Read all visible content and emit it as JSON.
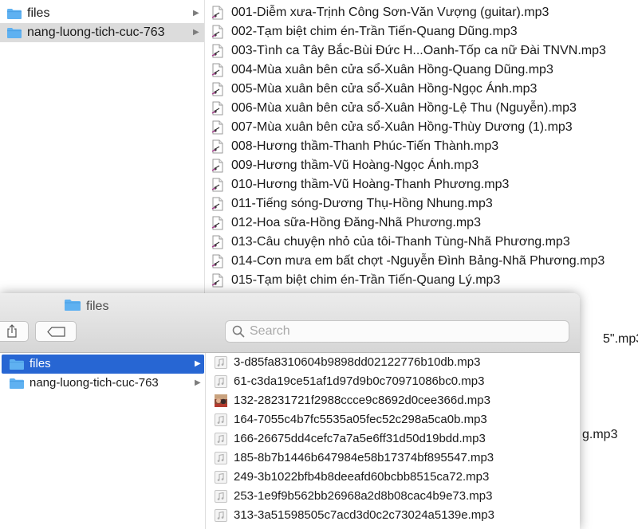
{
  "back_window": {
    "sidebar": [
      {
        "label": "files",
        "selected": false
      },
      {
        "label": "nang-luong-tich-cuc-763",
        "selected": true
      }
    ],
    "files": [
      "001-Diễm xưa-Trịnh Công Sơn-Văn Vượng (guitar).mp3",
      "002-Tạm biệt chim én-Trần Tiến-Quang Dũng.mp3",
      "003-Tình ca Tây Bắc-Bùi Đức H...Oanh-Tốp ca nữ Đài TNVN.mp3",
      "004-Mùa xuân bên cửa sổ-Xuân Hồng-Quang Dũng.mp3",
      "005-Mùa xuân bên cửa sổ-Xuân Hồng-Ngọc Ánh.mp3",
      "006-Mùa xuân bên cửa sổ-Xuân Hồng-Lệ Thu (Nguyễn).mp3",
      "007-Mùa xuân bên cửa sổ-Xuân Hồng-Thùy Dương (1).mp3",
      "008-Hương thầm-Thanh Phúc-Tiến Thành.mp3",
      "009-Hương thầm-Vũ Hoàng-Ngọc Ánh.mp3",
      "010-Hương thầm-Vũ Hoàng-Thanh Phương.mp3",
      "011-Tiếng sóng-Dương Thụ-Hồng Nhung.mp3",
      "012-Hoa sữa-Hồng Đăng-Nhã Phương.mp3",
      "013-Câu chuyện nhỏ của tôi-Thanh Tùng-Nhã Phương.mp3",
      "014-Cơn mưa em bất chợt -Nguyễn Đình Bảng-Nhã Phương.mp3",
      "015-Tạm biệt chim én-Trần Tiến-Quang Lý.mp3"
    ],
    "peek_1": "5\".mp3",
    "peek_2": "g.mp3"
  },
  "front_window": {
    "title": "files",
    "search_placeholder": "Search",
    "sidebar": [
      {
        "label": "files",
        "selected": true
      },
      {
        "label": "nang-luong-tich-cuc-763",
        "selected": false
      }
    ],
    "files": [
      {
        "name": "3-d85fa8310604b9898dd02122776b10db.mp3",
        "icon": "audio-file-icon"
      },
      {
        "name": "61-c3da19ce51af1d97d9b0c70971086bc0.mp3",
        "icon": "audio-file-icon"
      },
      {
        "name": "132-28231721f2988ccce9c8692d0cee366d.mp3",
        "icon": "album-art-icon"
      },
      {
        "name": "164-7055c4b7fc5535a05fec52c298a5ca0b.mp3",
        "icon": "audio-file-icon"
      },
      {
        "name": "166-26675dd4cefc7a7a5e6ff31d50d19bdd.mp3",
        "icon": "audio-file-icon"
      },
      {
        "name": "185-8b7b1446b647984e58b17374bf895547.mp3",
        "icon": "audio-file-icon"
      },
      {
        "name": "249-3b1022bfb4b8deeafd60bcbb8515ca72.mp3",
        "icon": "audio-file-icon"
      },
      {
        "name": "253-1e9f9b562bb26968a2d8b08cac4b9e73.mp3",
        "icon": "audio-file-icon"
      },
      {
        "name": "313-3a51598505c7acd3d0c2c73024a5139e.mp3",
        "icon": "audio-file-icon"
      }
    ]
  },
  "colors": {
    "selection_blue": "#2766d3",
    "folder_blue": "#5fb1f1",
    "inactive_selection": "#dcdcdc"
  }
}
